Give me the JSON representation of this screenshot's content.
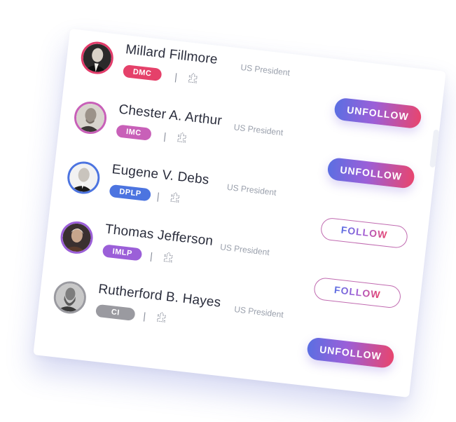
{
  "colors": {
    "accent_gradient_start": "#5b6fe2",
    "accent_gradient_end": "#e8456e"
  },
  "people": [
    {
      "name": "Millard Fillmore",
      "role": "US President",
      "badge": "DMC",
      "badge_color": "#e5416a",
      "avatar_border": "#e23b6a",
      "separator": "|",
      "icon": "puzzle-icon",
      "button": "UNFOLLOW",
      "button_state": "unfollow"
    },
    {
      "name": "Chester A. Arthur",
      "role": "US President",
      "badge": "IMC",
      "badge_color": "#c860b8",
      "avatar_border": "#c860b8",
      "separator": "|",
      "icon": "puzzle-icon",
      "button": "UNFOLLOW",
      "button_state": "unfollow"
    },
    {
      "name": "Eugene V. Debs",
      "role": "US President",
      "badge": "DPLP",
      "badge_color": "#4c74e0",
      "avatar_border": "#4c74e0",
      "separator": "|",
      "icon": "puzzle-icon",
      "button": "FOLLOW",
      "button_state": "follow"
    },
    {
      "name": "Thomas Jefferson",
      "role": "US President",
      "badge": "IMLP",
      "badge_color": "#9b5fd8",
      "avatar_border": "#9b5fd8",
      "separator": "|",
      "icon": "puzzle-icon",
      "button": "FOLLOW",
      "button_state": "follow"
    },
    {
      "name": "Rutherford B. Hayes",
      "role": "US President",
      "badge": "CI",
      "badge_color": "#9a9aa0",
      "avatar_border": "#9a9aa0",
      "separator": "|",
      "icon": "puzzle-icon",
      "button": "UNFOLLOW",
      "button_state": "unfollow"
    }
  ]
}
